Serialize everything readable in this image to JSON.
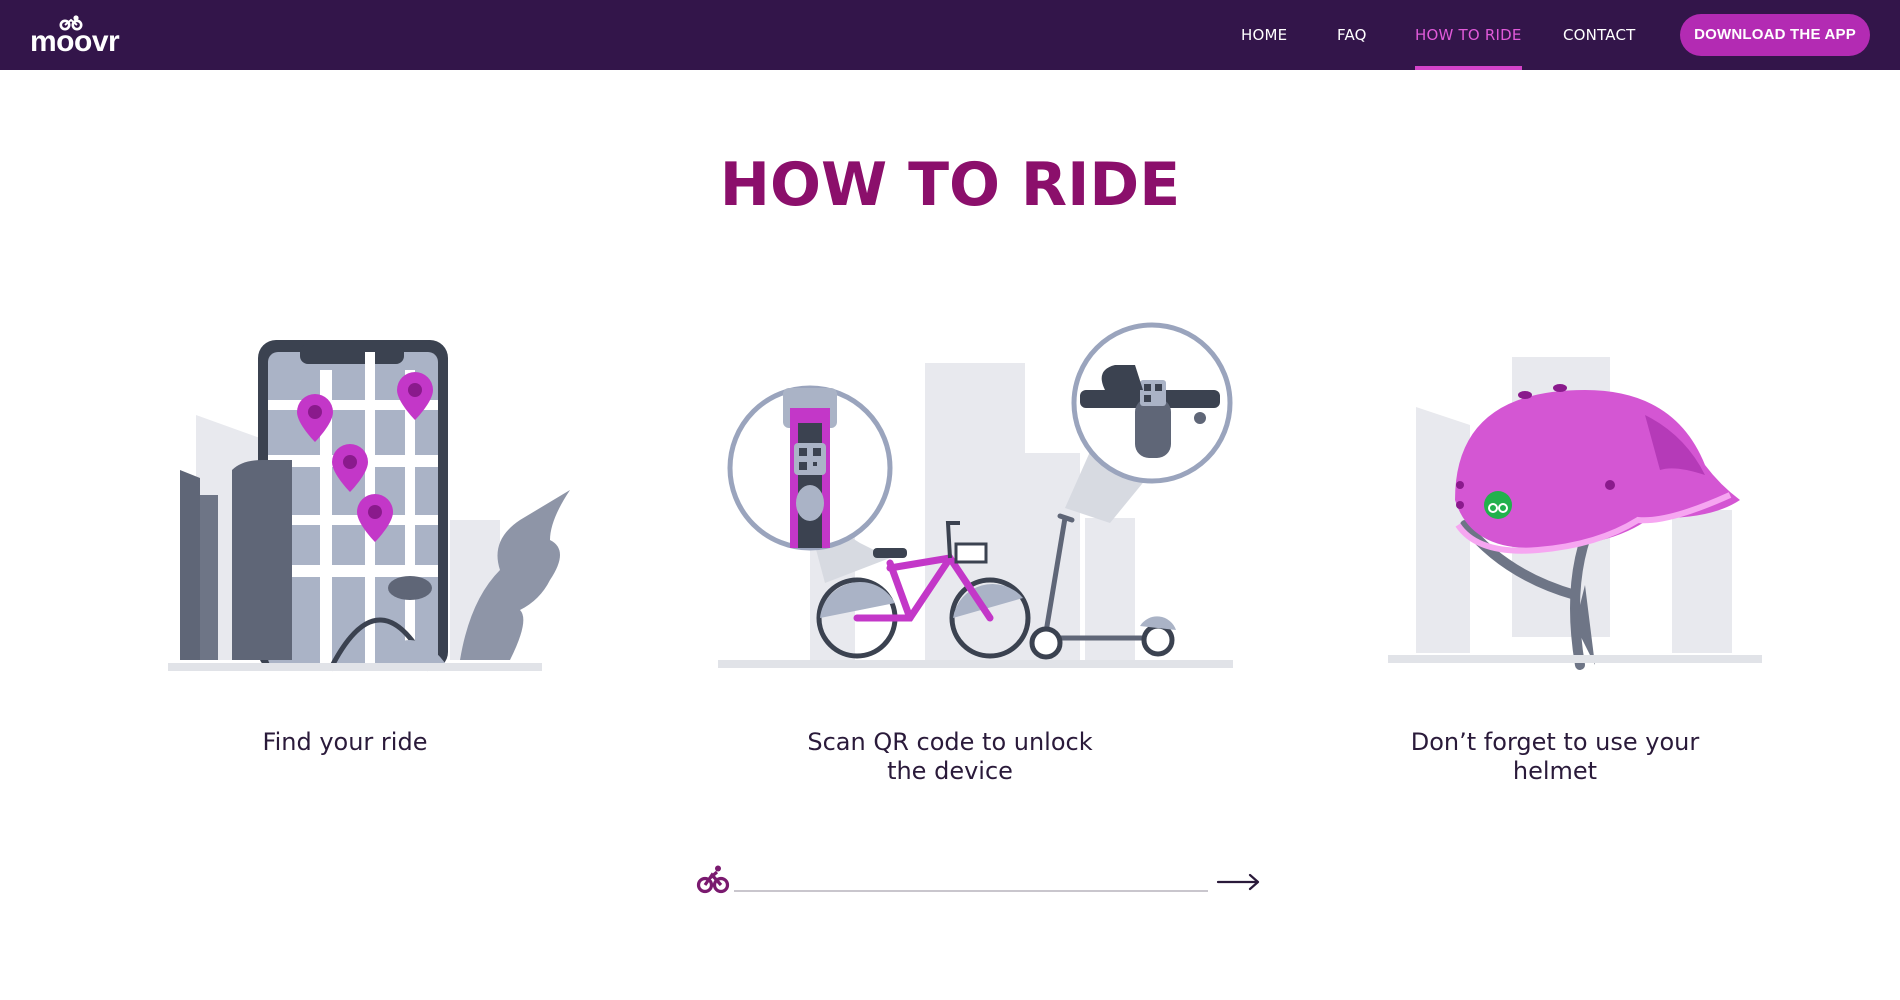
{
  "header": {
    "logo_text": "moovr",
    "nav": {
      "home": "HOME",
      "faq": "FAQ",
      "how_to_ride": "HOW TO RIDE",
      "contact": "CONTACT"
    },
    "active_nav": "HOW TO RIDE",
    "download_button": "DOWNLOAD THE APP"
  },
  "main": {
    "title": "HOW TO RIDE",
    "steps": [
      {
        "caption": "Find your ride",
        "icon": "phone-map-icon"
      },
      {
        "caption": "Scan QR code to unlock the device",
        "icon": "bike-scooter-qr-icon"
      },
      {
        "caption": "Don’t forget to use your helmet",
        "icon": "helmet-icon"
      }
    ],
    "carousel": {
      "current_step": 1,
      "total_steps": 3,
      "progress_icon": "bike-icon",
      "next_icon": "arrow-right-icon"
    }
  },
  "colors": {
    "header_bg": "#33154a",
    "accent": "#b32bb3",
    "active_nav": "#e05ad9",
    "title": "#8b0f6b",
    "caption": "#2a1a3a"
  }
}
